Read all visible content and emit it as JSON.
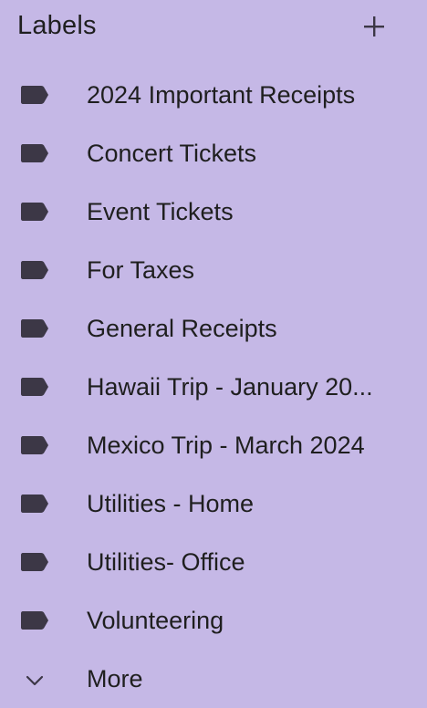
{
  "header": {
    "title": "Labels",
    "add_icon": "plus-icon"
  },
  "labels": [
    {
      "label": "2024 Important Receipts",
      "icon": "label-icon"
    },
    {
      "label": "Concert Tickets",
      "icon": "label-icon"
    },
    {
      "label": "Event Tickets",
      "icon": "label-icon"
    },
    {
      "label": "For Taxes",
      "icon": "label-icon"
    },
    {
      "label": "General Receipts",
      "icon": "label-icon"
    },
    {
      "label": "Hawaii Trip - January 20...",
      "icon": "label-icon"
    },
    {
      "label": "Mexico Trip - March 2024",
      "icon": "label-icon"
    },
    {
      "label": "Utilities - Home",
      "icon": "label-icon"
    },
    {
      "label": "Utilities- Office",
      "icon": "label-icon"
    },
    {
      "label": "Volunteering",
      "icon": "label-icon"
    }
  ],
  "more": {
    "label": "More",
    "icon": "chevron-down-icon"
  },
  "colors": {
    "background": "#c5b8e6",
    "text": "#1f1f1f",
    "icon": "#3c3746"
  }
}
